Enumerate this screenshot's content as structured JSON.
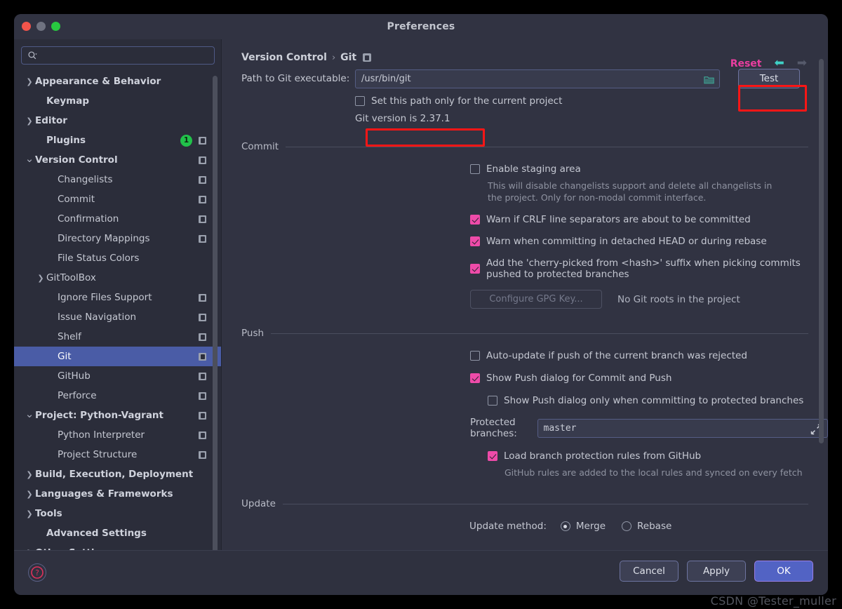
{
  "window": {
    "title": "Preferences",
    "traffic_lights": [
      "close",
      "minimize",
      "zoom"
    ]
  },
  "sidebar": {
    "search": {
      "value": "",
      "placeholder": ""
    },
    "items": [
      {
        "label": "Appearance & Behavior",
        "indent": 0,
        "arrow": "right",
        "bold": true,
        "badge": false,
        "count": null,
        "selected": false
      },
      {
        "label": "Keymap",
        "indent": 1,
        "arrow": "",
        "bold": true,
        "badge": false,
        "count": null,
        "selected": false
      },
      {
        "label": "Editor",
        "indent": 0,
        "arrow": "right",
        "bold": true,
        "badge": false,
        "count": null,
        "selected": false
      },
      {
        "label": "Plugins",
        "indent": 1,
        "arrow": "",
        "bold": true,
        "badge": true,
        "count": "1",
        "selected": false
      },
      {
        "label": "Version Control",
        "indent": 0,
        "arrow": "down",
        "bold": true,
        "badge": true,
        "count": null,
        "selected": false
      },
      {
        "label": "Changelists",
        "indent": 2,
        "arrow": "",
        "bold": false,
        "badge": true,
        "count": null,
        "selected": false
      },
      {
        "label": "Commit",
        "indent": 2,
        "arrow": "",
        "bold": false,
        "badge": true,
        "count": null,
        "selected": false
      },
      {
        "label": "Confirmation",
        "indent": 2,
        "arrow": "",
        "bold": false,
        "badge": true,
        "count": null,
        "selected": false
      },
      {
        "label": "Directory Mappings",
        "indent": 2,
        "arrow": "",
        "bold": false,
        "badge": true,
        "count": null,
        "selected": false
      },
      {
        "label": "File Status Colors",
        "indent": 2,
        "arrow": "",
        "bold": false,
        "badge": false,
        "count": null,
        "selected": false
      },
      {
        "label": "GitToolBox",
        "indent": 1,
        "arrow": "right",
        "bold": false,
        "badge": false,
        "count": null,
        "selected": false
      },
      {
        "label": "Ignore Files Support",
        "indent": 2,
        "arrow": "",
        "bold": false,
        "badge": true,
        "count": null,
        "selected": false
      },
      {
        "label": "Issue Navigation",
        "indent": 2,
        "arrow": "",
        "bold": false,
        "badge": true,
        "count": null,
        "selected": false
      },
      {
        "label": "Shelf",
        "indent": 2,
        "arrow": "",
        "bold": false,
        "badge": true,
        "count": null,
        "selected": false
      },
      {
        "label": "Git",
        "indent": 2,
        "arrow": "",
        "bold": false,
        "badge": true,
        "count": null,
        "selected": true
      },
      {
        "label": "GitHub",
        "indent": 2,
        "arrow": "",
        "bold": false,
        "badge": true,
        "count": null,
        "selected": false
      },
      {
        "label": "Perforce",
        "indent": 2,
        "arrow": "",
        "bold": false,
        "badge": true,
        "count": null,
        "selected": false
      },
      {
        "label": "Project: Python-Vagrant",
        "indent": 0,
        "arrow": "down",
        "bold": true,
        "badge": true,
        "count": null,
        "selected": false
      },
      {
        "label": "Python Interpreter",
        "indent": 2,
        "arrow": "",
        "bold": false,
        "badge": true,
        "count": null,
        "selected": false
      },
      {
        "label": "Project Structure",
        "indent": 2,
        "arrow": "",
        "bold": false,
        "badge": true,
        "count": null,
        "selected": false
      },
      {
        "label": "Build, Execution, Deployment",
        "indent": 0,
        "arrow": "right",
        "bold": true,
        "badge": false,
        "count": null,
        "selected": false
      },
      {
        "label": "Languages & Frameworks",
        "indent": 0,
        "arrow": "right",
        "bold": true,
        "badge": false,
        "count": null,
        "selected": false
      },
      {
        "label": "Tools",
        "indent": 0,
        "arrow": "right",
        "bold": true,
        "badge": false,
        "count": null,
        "selected": false
      },
      {
        "label": "Advanced Settings",
        "indent": 1,
        "arrow": "",
        "bold": true,
        "badge": false,
        "count": null,
        "selected": false
      },
      {
        "label": "Other Settings",
        "indent": 0,
        "arrow": "right",
        "bold": true,
        "badge": false,
        "count": null,
        "selected": false
      }
    ]
  },
  "main": {
    "breadcrumb": {
      "root": "Version Control",
      "separator": "›",
      "leaf": "Git"
    },
    "reset_label": "Reset",
    "path": {
      "label": "Path to Git executable:",
      "value": "/usr/bin/git",
      "placeholder": "",
      "test_button": "Test"
    },
    "set_path_checkbox": {
      "label": "Set this path only for the current project",
      "checked": false
    },
    "git_version_text": "Git version is 2.37.1",
    "commit": {
      "title": "Commit",
      "enable_staging": {
        "label": "Enable staging area",
        "checked": false
      },
      "staging_hint_line1": "This will disable changelists support and delete all changelists in",
      "staging_hint_line2": "the project. Only for non-modal commit interface.",
      "warn_crlf": {
        "label": "Warn if CRLF line separators are about to be committed",
        "checked": true
      },
      "warn_detached": {
        "label": "Warn when committing in detached HEAD or during rebase",
        "checked": true
      },
      "cherry_pick": {
        "label": "Add the 'cherry-picked from <hash>' suffix when picking commits pushed to protected branches",
        "checked": true
      },
      "gpg_button": "Configure GPG Key...",
      "gpg_note": "No Git roots in the project"
    },
    "push": {
      "title": "Push",
      "auto_update": {
        "label": "Auto-update if push of the current branch was rejected",
        "checked": false
      },
      "show_push_dialog": {
        "label": "Show Push dialog for Commit and Push",
        "checked": true
      },
      "show_push_protected": {
        "label": "Show Push dialog only when committing to protected branches",
        "checked": false
      },
      "protected_branches_label": "Protected branches:",
      "protected_branches_value": "master",
      "load_rules": {
        "label": "Load branch protection rules from GitHub",
        "checked": true
      },
      "load_rules_hint": "GitHub rules are added to the local rules and synced on every fetch"
    },
    "update": {
      "title": "Update",
      "method_label": "Update method:",
      "options": [
        {
          "label": "Merge",
          "selected": true
        },
        {
          "label": "Rebase",
          "selected": false
        }
      ]
    }
  },
  "footer": {
    "help_glyph": "?",
    "cancel": "Cancel",
    "apply": "Apply",
    "ok": "OK"
  },
  "watermark": "CSDN @Tester_muller",
  "colors": {
    "accent_checkbox": "#ee4ba9",
    "reset_link": "#ea3ea0",
    "selection": "#4a5ca6",
    "primary_button": "#5263c4",
    "annotation_box": "#f91616",
    "badge_green": "#21c14a",
    "nav_arrow_active": "#3fd2c7"
  }
}
